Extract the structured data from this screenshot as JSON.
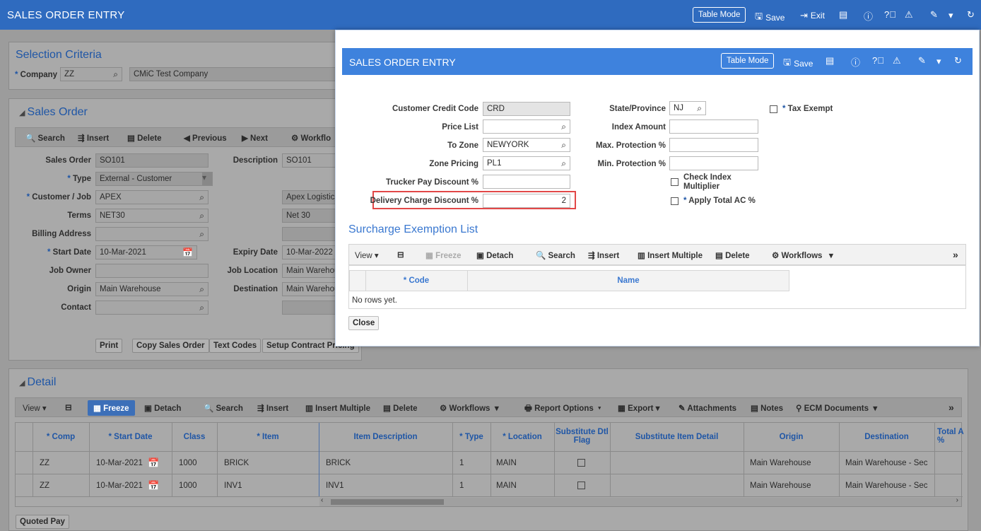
{
  "app": {
    "title": "SALES ORDER ENTRY",
    "table_mode": "Table Mode",
    "save": "Save",
    "exit": "Exit"
  },
  "selection": {
    "title": "Selection Criteria",
    "company_label": "Company",
    "company_code": "ZZ",
    "company_name": "CMiC Test Company"
  },
  "sales_order": {
    "title": "Sales Order",
    "toolbar": [
      "Search",
      "Insert",
      "Delete",
      "Previous",
      "Next",
      "Workflo"
    ],
    "labels": {
      "sales_order": "Sales Order",
      "type": "Type",
      "customer": "Customer / Job",
      "terms": "Terms",
      "billing": "Billing Address",
      "start_date": "Start Date",
      "job_owner": "Job Owner",
      "origin": "Origin",
      "contact": "Contact",
      "description": "Description",
      "expiry": "Expiry Date",
      "job_location": "Job Location",
      "destination": "Destination"
    },
    "values": {
      "sales_order": "SO101",
      "type": "External - Customer",
      "customer": "APEX",
      "terms": "NET30",
      "start_date": "10-Mar-2021",
      "origin": "Main Warehouse",
      "description": "SO101",
      "customer_name": "Apex Logistics",
      "terms_name": "Net 30",
      "expiry": "10-Mar-2022",
      "job_location": "Main Warehou",
      "destination": "Main Warehou"
    },
    "buttons": [
      "Print",
      "Copy Sales Order",
      "Text Codes",
      "Setup Contract Pricing"
    ]
  },
  "detail": {
    "title": "Detail",
    "toolbar": {
      "view": "View",
      "freeze": "Freeze",
      "detach": "Detach",
      "search": "Search",
      "insert": "Insert",
      "insert_multiple": "Insert Multiple",
      "delete": "Delete",
      "workflows": "Workflows",
      "report_options": "Report Options",
      "export": "Export",
      "attachments": "Attachments",
      "notes": "Notes",
      "ecm": "ECM Documents"
    },
    "columns": [
      "* Comp",
      "* Start Date",
      "Class",
      "* Item",
      "Item Description",
      "* Type",
      "* Location",
      "Substitute Dtl Flag",
      "Substitute Item Detail",
      "Origin",
      "Destination",
      "Total A %"
    ],
    "rows": [
      {
        "comp": "ZZ",
        "start": "10-Mar-2021",
        "class": "1000",
        "item": "BRICK",
        "desc": "BRICK",
        "type": "1",
        "location": "MAIN",
        "origin": "Main Warehouse",
        "destination": "Main Warehouse - Sec"
      },
      {
        "comp": "ZZ",
        "start": "10-Mar-2021",
        "class": "1000",
        "item": "INV1",
        "desc": "INV1",
        "type": "1",
        "location": "MAIN",
        "origin": "Main Warehouse",
        "destination": "Main Warehouse - Sec"
      }
    ],
    "quoted_pay": "Quoted Pay"
  },
  "modal": {
    "title": "SALES ORDER ENTRY",
    "table_mode": "Table Mode",
    "save": "Save",
    "labels": {
      "credit_code": "Customer Credit Code",
      "price_list": "Price List",
      "to_zone": "To Zone",
      "zone_pricing": "Zone Pricing",
      "trucker_pay": "Trucker Pay Discount %",
      "delivery_charge": "Delivery Charge Discount %",
      "state": "State/Province",
      "index_amount": "Index Amount",
      "max_protection": "Max. Protection %",
      "min_protection": "Min. Protection %",
      "check_index_1": "Check Index",
      "check_index_2": "Multiplier",
      "apply_total": "Apply Total AC %",
      "tax_exempt": "Tax Exempt"
    },
    "values": {
      "credit_code": "CRD",
      "to_zone": "NEWYORK",
      "zone_pricing": "PL1",
      "delivery_charge": "2",
      "state": "NJ"
    },
    "surcharge": {
      "title": "Surcharge Exemption List",
      "toolbar": {
        "view": "View",
        "freeze": "Freeze",
        "detach": "Detach",
        "search": "Search",
        "insert": "Insert",
        "insert_multiple": "Insert Multiple",
        "delete": "Delete",
        "workflows": "Workflows"
      },
      "col_code": "* Code",
      "col_name": "Name",
      "empty": "No rows yet."
    },
    "close": "Close"
  }
}
